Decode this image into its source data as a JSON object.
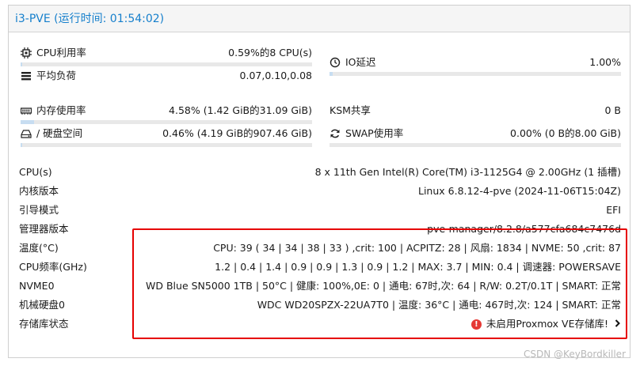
{
  "header": {
    "title": "i3-PVE (运行时间: 01:54:02)"
  },
  "cpu_usage": {
    "label": "CPU利用率",
    "value": "0.59%的8 CPU(s)",
    "fraction": 0.0059
  },
  "load_avg": {
    "label": "平均负荷",
    "value": "0.07,0.10,0.08"
  },
  "io_delay": {
    "label": "IO延迟",
    "value": "1.00%",
    "fraction": 0.01
  },
  "mem_usage": {
    "label": "内存使用率",
    "value": "4.58% (1.42 GiB的31.09 GiB)",
    "fraction": 0.0458
  },
  "ksm": {
    "label": "KSM共享",
    "value": "0 B"
  },
  "disk": {
    "label": "/ 硬盘空间",
    "value": "0.46% (4.19 GiB的907.46 GiB)",
    "fraction": 0.0046
  },
  "swap": {
    "label": "SWAP使用率",
    "value": "0.00% (0 B的8.00 GiB)",
    "fraction": 0.0
  },
  "info_rows": [
    {
      "label": "CPU(s)",
      "value": "8 x 11th Gen Intel(R) Core(TM) i3-1125G4 @ 2.00GHz (1 插槽)"
    },
    {
      "label": "内核版本",
      "value": "Linux 6.8.12-4-pve (2024-11-06T15:04Z)"
    },
    {
      "label": "引导模式",
      "value": "EFI"
    },
    {
      "label": "管理器版本",
      "value": "pve-manager/8.2.8/a577cfa684c7476d"
    },
    {
      "label": "温度(°C)",
      "value": "CPU: 39 ( 34 | 34 | 38 | 33 ) ,crit: 100 | ACPITZ: 28 | 风扇: 1834 | NVME: 50 ,crit: 87"
    },
    {
      "label": "CPU频率(GHz)",
      "value": "1.2 | 0.4 | 1.4 | 0.9 | 0.9 | 1.3 | 0.9 | 1.2 | MAX: 3.7 | MIN: 0.4 | 调速器: POWERSAVE"
    },
    {
      "label": "NVME0",
      "value": "WD Blue SN5000 1TB | 50°C | 健康: 100%,0E: 0 | 通电: 67时,次: 64 | R/W: 0.2T/0.1T | SMART: 正常"
    },
    {
      "label": "机械硬盘0",
      "value": "WDC WD20SPZX-22UA7T0 | 温度: 36°C | 通电: 467时,次: 124 | SMART: 正常"
    }
  ],
  "storage": {
    "label": "存储库状态",
    "warning": "未启用Proxmox VE存储库!",
    "warn_mark": "!"
  },
  "watermark": "CSDN @KeyBordkiller"
}
